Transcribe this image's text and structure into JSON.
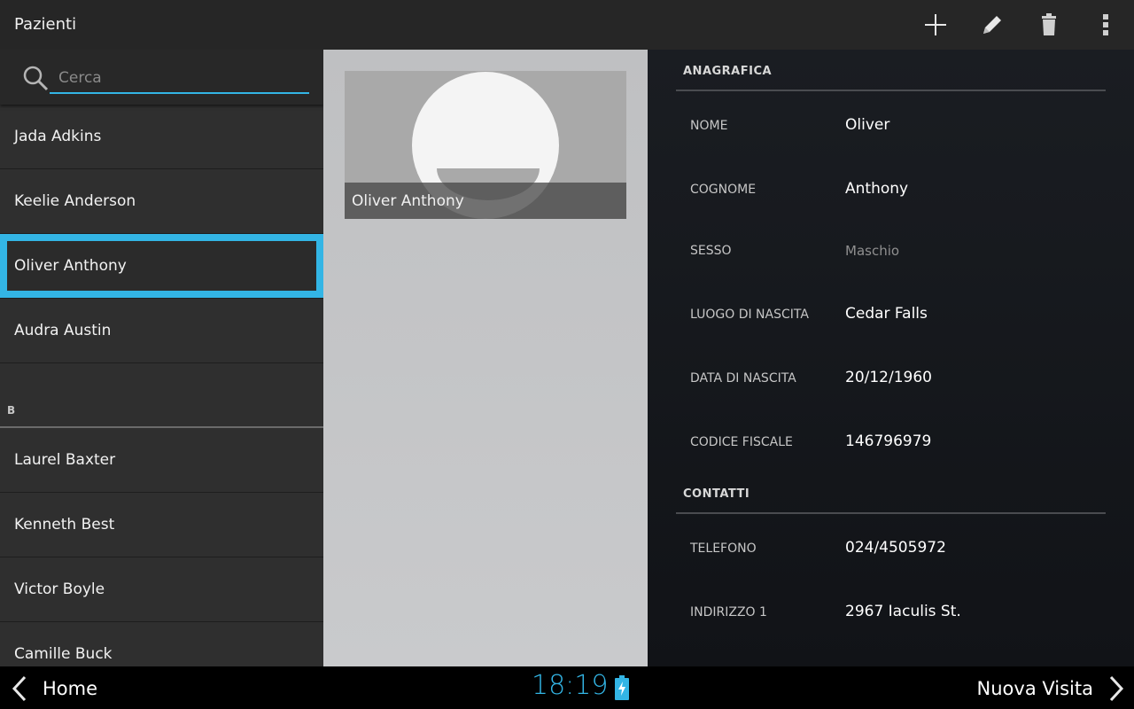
{
  "action_bar": {
    "title": "Pazienti",
    "actions": [
      "plus-icon",
      "pencil-icon",
      "trash-icon",
      "overflow-icon"
    ]
  },
  "search": {
    "placeholder": "Cerca",
    "value": ""
  },
  "list": {
    "rows": [
      "Jada Adkins",
      "Keelie Anderson",
      "Oliver Anthony",
      "Audra Austin"
    ],
    "section_b": "B",
    "rows_b": [
      "Laurel Baxter",
      "Kenneth Best",
      "Victor Boyle",
      "Camille Buck"
    ]
  },
  "photo": {
    "caption": "Oliver Anthony"
  },
  "details": {
    "anagrafica_title": "ANAGRAFICA",
    "contatti_title": "CONTATTI",
    "nome_label": "NOME",
    "nome_value": "Oliver",
    "cognome_label": "COGNOME",
    "cognome_value": "Anthony",
    "sesso_label": "SESSO",
    "sesso_value": "Maschio",
    "luogo_label": "LUOGO DI NASCITA",
    "luogo_value": "Cedar Falls",
    "data_label": "DATA DI NASCITA",
    "data_value": "20/12/1960",
    "cf_label": "CODICE FISCALE",
    "cf_value": "146796979",
    "tel_label": "TELEFONO",
    "tel_value": "024/4505972",
    "ind_label": "INDIRIZZO 1",
    "ind_value": "2967 Iaculis St."
  },
  "nav": {
    "back_label": "Home",
    "forward_label": "Nuova Visita",
    "clock": "18:19"
  },
  "colors": {
    "accent": "#33b5e5",
    "action_bar": "#262626",
    "list_bg": "#2f2f2f"
  }
}
